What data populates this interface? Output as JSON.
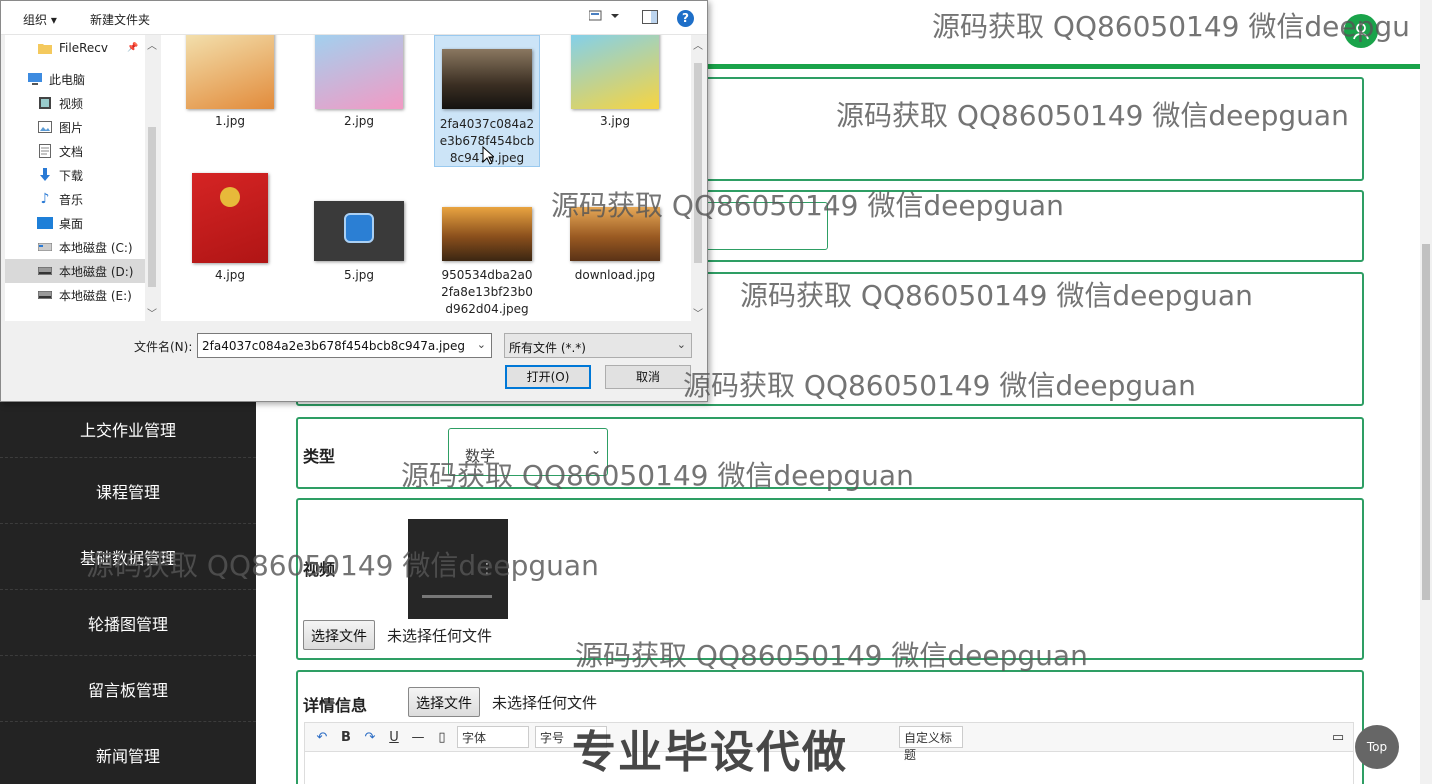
{
  "dialog": {
    "toolbar": {
      "organize": "组织 ▾",
      "new_folder": "新建文件夹",
      "help": "?"
    },
    "nav": [
      {
        "label": "FileRecv",
        "icon": "folder-icon",
        "pinned": "📌"
      },
      {
        "label": "此电脑",
        "icon": "computer-icon"
      },
      {
        "label": "视频",
        "icon": "video-folder-icon"
      },
      {
        "label": "图片",
        "icon": "pictures-folder-icon"
      },
      {
        "label": "文档",
        "icon": "documents-folder-icon"
      },
      {
        "label": "下载",
        "icon": "download-arrow-icon"
      },
      {
        "label": "音乐",
        "icon": "music-note-icon"
      },
      {
        "label": "桌面",
        "icon": "desktop-icon"
      },
      {
        "label": "本地磁盘 (C:)",
        "icon": "drive-icon"
      },
      {
        "label": "本地磁盘 (D:)",
        "icon": "drive-icon"
      },
      {
        "label": "本地磁盘 (E:)",
        "icon": "drive-icon"
      }
    ],
    "files": [
      {
        "name": "1.jpg",
        "colors": [
          "#f3e2b0",
          "#e28b3b"
        ]
      },
      {
        "name": "2.jpg",
        "colors": [
          "#9fd2f0",
          "#f29ac4"
        ]
      },
      {
        "name": "2fa4037c084a2e3b678f454bcb8c947a.jpeg",
        "display_name": "2fa4037c084a2\ne3b678f454bcb\n8c947a.jpeg",
        "colors": [
          "#6b5a49",
          "#1e1a16"
        ]
      },
      {
        "name": "3.jpg",
        "colors": [
          "#7fd0f0",
          "#f7d440"
        ]
      },
      {
        "name": "4.jpg",
        "colors": [
          "#d52424",
          "#b01515"
        ]
      },
      {
        "name": "5.jpg",
        "colors": [
          "#3a3a3a",
          "#2b7fd4"
        ]
      },
      {
        "name": "950534dba2a02fa8e13bf23b0d962d04.jpeg",
        "display_name": "950534dba2a0\n2fa8e13bf23b0\nd962d04.jpeg",
        "colors": [
          "#e9a441",
          "#3b2612"
        ]
      },
      {
        "name": "download.jpg",
        "colors": [
          "#e6a857",
          "#5a3216"
        ]
      }
    ],
    "filename_label": "文件名(N):",
    "filename_value": "2fa4037c084a2e3b678f454bcb8c947a.jpeg",
    "filter_value": "所有文件 (*.*)",
    "open_label": "打开(O)",
    "cancel_label": "取消"
  },
  "sidebar": {
    "items": [
      "上交作业管理",
      "课程管理",
      "基础数据管理",
      "轮播图管理",
      "留言板管理",
      "新闻管理"
    ]
  },
  "form": {
    "type_label": "类型",
    "type_value": "数学",
    "video_label": "视频",
    "video_choose": "选择文件",
    "video_none": "未选择任何文件",
    "detail_label": "详情信息",
    "detail_choose": "选择文件",
    "detail_none": "未选择任何文件",
    "editor": {
      "font": "字体",
      "size": "字号",
      "custom_title": "自定义标题"
    }
  },
  "top_button": "Top",
  "watermarks": {
    "text": "源码获取 QQ86050149 微信deepguan",
    "text_cut": "源码获取 QQ86050149 微信deepgu",
    "big": "专业毕设代做"
  },
  "colors": {
    "accent": "#1aa34a",
    "panel_border": "#2e9e64",
    "sidebar_bg": "#232323"
  }
}
